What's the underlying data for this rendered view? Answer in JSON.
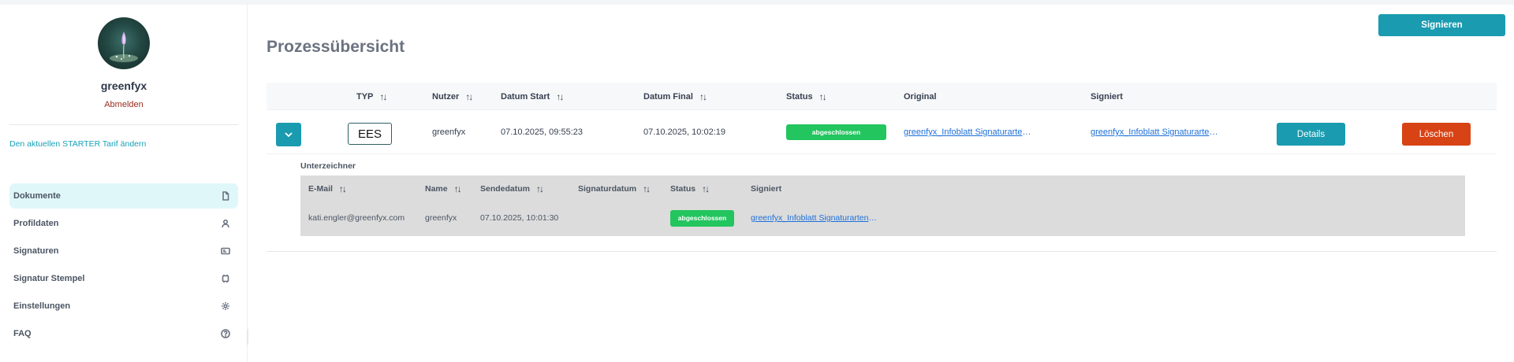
{
  "user": {
    "name": "greenfyx",
    "logout_label": "Abmelden",
    "tariff_link": "Den aktuellen STARTER Tarif ändern"
  },
  "nav": {
    "items": [
      {
        "label": "Dokumente",
        "icon": "document-icon",
        "active": true
      },
      {
        "label": "Profildaten",
        "icon": "user-icon",
        "active": false
      },
      {
        "label": "Signaturen",
        "icon": "id-card-icon",
        "active": false
      },
      {
        "label": "Signatur Stempel",
        "icon": "stamp-icon",
        "active": false
      },
      {
        "label": "Einstellungen",
        "icon": "gear-icon",
        "active": false
      },
      {
        "label": "FAQ",
        "icon": "help-icon",
        "active": false
      }
    ]
  },
  "page": {
    "title": "Prozessübersicht",
    "sign_button": "Signieren"
  },
  "table": {
    "headers": {
      "type": "TYP",
      "user": "Nutzer",
      "date_start": "Datum Start",
      "date_final": "Datum Final",
      "status": "Status",
      "original": "Original",
      "signed": "Signiert"
    },
    "rows": [
      {
        "type": "EES",
        "user": "greenfyx",
        "date_start": "07.10.2025, 09:55:23",
        "date_final": "07.10.2025, 10:02:19",
        "status": "abgeschlossen",
        "original": "greenfyx_Infoblatt Signaturarten.pdf",
        "signed": "greenfyx_Infoblatt Signaturarten.pdf",
        "details_label": "Details",
        "delete_label": "Löschen"
      }
    ]
  },
  "signers": {
    "label": "Unterzeichner",
    "headers": {
      "email": "E-Mail",
      "name": "Name",
      "sent": "Sendedatum",
      "signed_date": "Signaturdatum",
      "status": "Status",
      "signed": "Signiert"
    },
    "rows": [
      {
        "email": "kati.engler@greenfyx.com",
        "name": "greenfyx",
        "sent": "07.10.2025, 10:01:30",
        "signed_date": "",
        "status": "abgeschlossen",
        "signed": "greenfyx_Infoblatt Signaturarten.pdf"
      }
    ]
  },
  "colors": {
    "accent": "#1a9bb0",
    "danger": "#d84315",
    "success": "#22c55e",
    "link": "#1d6fd8"
  }
}
